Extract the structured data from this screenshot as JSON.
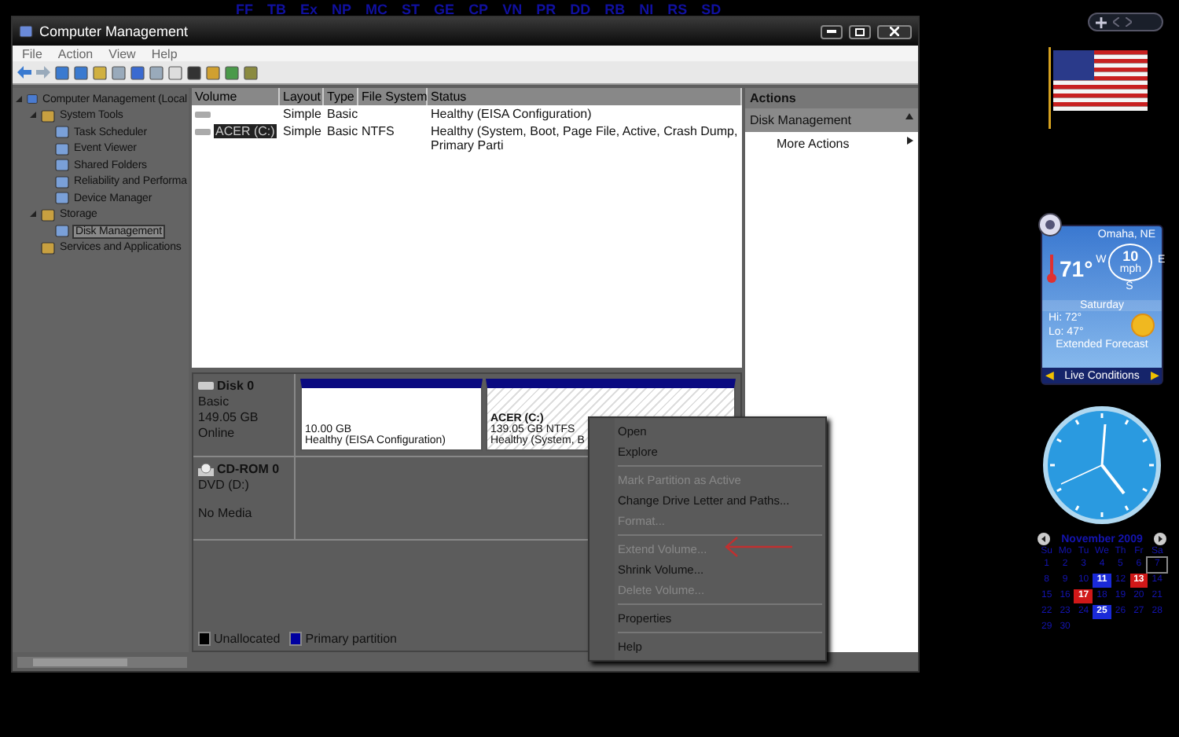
{
  "top_bar": {
    "shortcuts": [
      "FF",
      "TB",
      "Ex",
      "NP",
      "MC",
      "ST",
      "GE",
      "CP",
      "VN",
      "PR",
      "DD",
      "RB",
      "NI",
      "RS",
      "SD"
    ]
  },
  "window": {
    "title": "Computer Management",
    "menu": [
      "File",
      "Action",
      "View",
      "Help"
    ]
  },
  "tree": [
    {
      "label": "Computer Management (Local",
      "expanded": true,
      "selected": false,
      "children": [
        {
          "label": "System Tools",
          "expanded": true,
          "selected": false,
          "children": [
            {
              "label": "Task Scheduler",
              "selected": false
            },
            {
              "label": "Event Viewer",
              "selected": false
            },
            {
              "label": "Shared Folders",
              "selected": false
            },
            {
              "label": "Reliability and Performa",
              "selected": false
            },
            {
              "label": "Device Manager",
              "selected": false
            }
          ]
        },
        {
          "label": "Storage",
          "expanded": true,
          "selected": false,
          "children": [
            {
              "label": "Disk Management",
              "selected": true
            }
          ]
        },
        {
          "label": "Services and Applications",
          "selected": false
        }
      ]
    }
  ],
  "table": {
    "columns": [
      "Volume",
      "Layout",
      "Type",
      "File System",
      "Status"
    ],
    "rows": [
      {
        "cells": [
          "",
          "Simple",
          "Basic",
          "",
          "Healthy (EISA Configuration)"
        ],
        "selected": false
      },
      {
        "cells": [
          "ACER (C:)",
          "Simple",
          "Basic",
          "NTFS",
          "Healthy (System, Boot, Page File, Active, Crash Dump, Primary Parti"
        ],
        "selected": true
      }
    ]
  },
  "disks": [
    {
      "name": "Disk 0",
      "kind": "disk",
      "lines": [
        "Basic",
        "149.05 GB",
        "Online"
      ],
      "partitions": [
        {
          "size": "10.00 GB",
          "status": "Healthy (EISA Configuration)",
          "selected": false
        },
        {
          "label": "ACER  (C:)",
          "size": "139.05 GB NTFS",
          "status": "Healthy (System, B",
          "selected": true
        }
      ]
    },
    {
      "name": "CD-ROM 0",
      "kind": "cdrom",
      "lines": [
        "DVD (D:)",
        "No Media"
      ]
    }
  ],
  "legend": [
    {
      "label": "Unallocated",
      "color": "#000000"
    },
    {
      "label": "Primary partition",
      "color": "#0000a0"
    }
  ],
  "actions": {
    "title": "Actions",
    "section": "Disk Management",
    "items": [
      "More Actions"
    ]
  },
  "context_menu": [
    {
      "label": "Open",
      "disabled": false,
      "kind": "item"
    },
    {
      "label": "Explore",
      "disabled": false,
      "kind": "item"
    },
    {
      "kind": "separator"
    },
    {
      "label": "Mark Partition as Active",
      "disabled": true,
      "kind": "item"
    },
    {
      "label": "Change Drive Letter and Paths...",
      "disabled": false,
      "kind": "item"
    },
    {
      "label": "Format...",
      "disabled": true,
      "kind": "item"
    },
    {
      "kind": "separator"
    },
    {
      "label": "Extend Volume...",
      "disabled": true,
      "kind": "item"
    },
    {
      "label": "Shrink Volume...",
      "disabled": false,
      "kind": "item"
    },
    {
      "label": "Delete Volume...",
      "disabled": true,
      "kind": "item"
    },
    {
      "kind": "separator"
    },
    {
      "label": "Properties",
      "disabled": false,
      "kind": "item"
    },
    {
      "kind": "separator"
    },
    {
      "label": "Help",
      "disabled": false,
      "kind": "item"
    }
  ],
  "weather": {
    "city": "Omaha, NE",
    "temperature": "71°",
    "wind_speed": "10",
    "wind_unit": "mph",
    "compass": [
      "W",
      "E",
      "S"
    ],
    "day": "Saturday",
    "high": "Hi: 72°",
    "low": "Lo: 47°",
    "forecast_link": "Extended Forecast",
    "previous": "◀",
    "conditions_link": "Live Conditions",
    "next": "▶"
  },
  "calendar": {
    "month": "November 2009",
    "weekdays": [
      "Su",
      "Mo",
      "Tu",
      "We",
      "Th",
      "Fr",
      "Sa"
    ],
    "weeks": [
      [
        {
          "day": "1",
          "selected": false
        },
        {
          "day": "2",
          "selected": false
        },
        {
          "day": "3",
          "selected": false
        },
        {
          "day": "4",
          "selected": false
        },
        {
          "day": "5",
          "selected": false
        },
        {
          "day": "6",
          "selected": false
        },
        {
          "day": "7",
          "selected": true
        }
      ],
      [
        {
          "day": "8",
          "selected": false
        },
        {
          "day": "9",
          "selected": false
        },
        {
          "day": "10",
          "selected": false
        },
        {
          "day": "11",
          "selected": false,
          "color": "#1a2ad8"
        },
        {
          "day": "12",
          "selected": false
        },
        {
          "day": "13",
          "selected": false,
          "color": "#d01818"
        },
        {
          "day": "14",
          "selected": false
        }
      ],
      [
        {
          "day": "15",
          "selected": false
        },
        {
          "day": "16",
          "selected": false
        },
        {
          "day": "17",
          "selected": false,
          "color": "#d01818"
        },
        {
          "day": "18",
          "selected": false
        },
        {
          "day": "19",
          "selected": false
        },
        {
          "day": "20",
          "selected": false
        },
        {
          "day": "21",
          "selected": false
        }
      ],
      [
        {
          "day": "22",
          "selected": false
        },
        {
          "day": "23",
          "selected": false
        },
        {
          "day": "24",
          "selected": false
        },
        {
          "day": "25",
          "selected": false,
          "color": "#1a2ad8"
        },
        {
          "day": "26",
          "selected": false
        },
        {
          "day": "27",
          "selected": false
        },
        {
          "day": "28",
          "selected": false
        }
      ],
      [
        {
          "day": "29",
          "selected": false
        },
        {
          "day": "30",
          "selected": false
        }
      ]
    ]
  }
}
